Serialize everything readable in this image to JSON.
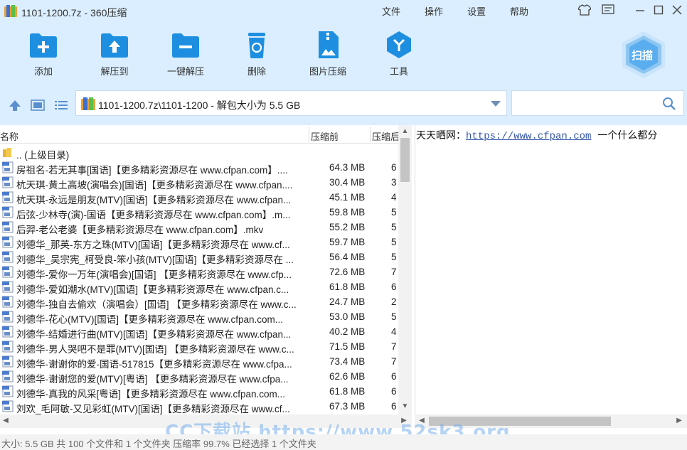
{
  "window": {
    "title": "1101-1200.7z - 360压缩",
    "menus": [
      "文件",
      "操作",
      "设置",
      "帮助"
    ]
  },
  "toolbar": {
    "items": [
      {
        "label": "添加",
        "icon": "add-folder-icon"
      },
      {
        "label": "解压到",
        "icon": "extract-to-icon"
      },
      {
        "label": "一键解压",
        "icon": "one-click-extract-icon"
      },
      {
        "label": "删除",
        "icon": "delete-icon"
      },
      {
        "label": "图片压缩",
        "icon": "image-compress-icon"
      },
      {
        "label": "工具",
        "icon": "tools-icon"
      }
    ],
    "scan_label": "扫描"
  },
  "address": {
    "path": "1101-1200.7z\\1101-1200 - 解包大小为 5.5 GB",
    "search_value": ""
  },
  "columns": {
    "name": "名称",
    "size": "压缩前",
    "compressed": "压缩后"
  },
  "files": [
    {
      "name": ".. (上级目录)",
      "size": "",
      "compressed": "",
      "type": "folder"
    },
    {
      "name": "房祖名-若无其事[国语]【更多精彩资源尽在 www.cfpan.com】....",
      "size": "64.3 MB",
      "compressed": "6",
      "type": "video"
    },
    {
      "name": "杭天琪-黄土高坡(演唱会)[国语]【更多精彩资源尽在 www.cfpan....",
      "size": "30.4 MB",
      "compressed": "3",
      "type": "video"
    },
    {
      "name": "杭天琪-永远是朋友(MTV)[国语]【更多精彩资源尽在 www.cfpan...",
      "size": "45.1 MB",
      "compressed": "4",
      "type": "video"
    },
    {
      "name": "后弦-少林寺(演)-国语【更多精彩资源尽在 www.cfpan.com】.m...",
      "size": "59.8 MB",
      "compressed": "5",
      "type": "video"
    },
    {
      "name": "后羿-老公老婆【更多精彩资源尽在 www.cfpan.com】.mkv",
      "size": "55.2 MB",
      "compressed": "5",
      "type": "video"
    },
    {
      "name": "刘德华_那英-东方之珠(MTV)[国语]【更多精彩资源尽在 www.cf...",
      "size": "59.7 MB",
      "compressed": "5",
      "type": "video"
    },
    {
      "name": "刘德华_吴宗宪_柯受良-笨小孩(MTV)[国语]【更多精彩资源尽在 ...",
      "size": "56.4 MB",
      "compressed": "5",
      "type": "video"
    },
    {
      "name": "刘德华-爱你一万年(演唱会)[国语] 【更多精彩资源尽在 www.cfp...",
      "size": "72.6 MB",
      "compressed": "7",
      "type": "video"
    },
    {
      "name": "刘德华-爱如潮水(MTV)[国语]【更多精彩资源尽在 www.cfpan.c...",
      "size": "61.8 MB",
      "compressed": "6",
      "type": "video"
    },
    {
      "name": "刘德华-独自去偷欢（演唱会）[国语] 【更多精彩资源尽在 www.c...",
      "size": "24.7 MB",
      "compressed": "2",
      "type": "video"
    },
    {
      "name": "刘德华-花心(MTV)[国语]【更多精彩资源尽在 www.cfpan.com...",
      "size": "53.0 MB",
      "compressed": "5",
      "type": "video"
    },
    {
      "name": "刘德华-结婚进行曲(MTV)[国语]【更多精彩资源尽在 www.cfpan...",
      "size": "40.2 MB",
      "compressed": "4",
      "type": "video"
    },
    {
      "name": "刘德华-男人哭吧不是罪(MTV)[国语] 【更多精彩资源尽在 www.c...",
      "size": "71.5 MB",
      "compressed": "7",
      "type": "video"
    },
    {
      "name": "刘德华-谢谢你的爱-国语-517815【更多精彩资源尽在 www.cfpa...",
      "size": "73.4 MB",
      "compressed": "7",
      "type": "video"
    },
    {
      "name": "刘德华-谢谢您的爱(MTV)[粤语] 【更多精彩资源尽在 www.cfpa...",
      "size": "62.6 MB",
      "compressed": "6",
      "type": "video"
    },
    {
      "name": "刘德华-真我的风采[粤语]【更多精彩资源尽在 www.cfpan.com...",
      "size": "61.8 MB",
      "compressed": "6",
      "type": "video"
    },
    {
      "name": "刘欢_毛阿敏-又见彩虹(MTV)[国语]【更多精彩资源尽在 www.cf...",
      "size": "67.3 MB",
      "compressed": "6",
      "type": "video"
    }
  ],
  "preview": {
    "prefix": "天天晒网：",
    "link": "https://www.cfpan.com",
    "suffix": "  一个什么都分"
  },
  "watermark": "CC下载站 https://www.52sk3.org",
  "status": "大小: 5.5 GB 共 100 个文件和 1 个文件夹 压缩率 99.7% 已经选择 1 个文件夹",
  "colors": {
    "chrome_bg": "#dbeeff",
    "accent_blue": "#1e8fe0"
  }
}
